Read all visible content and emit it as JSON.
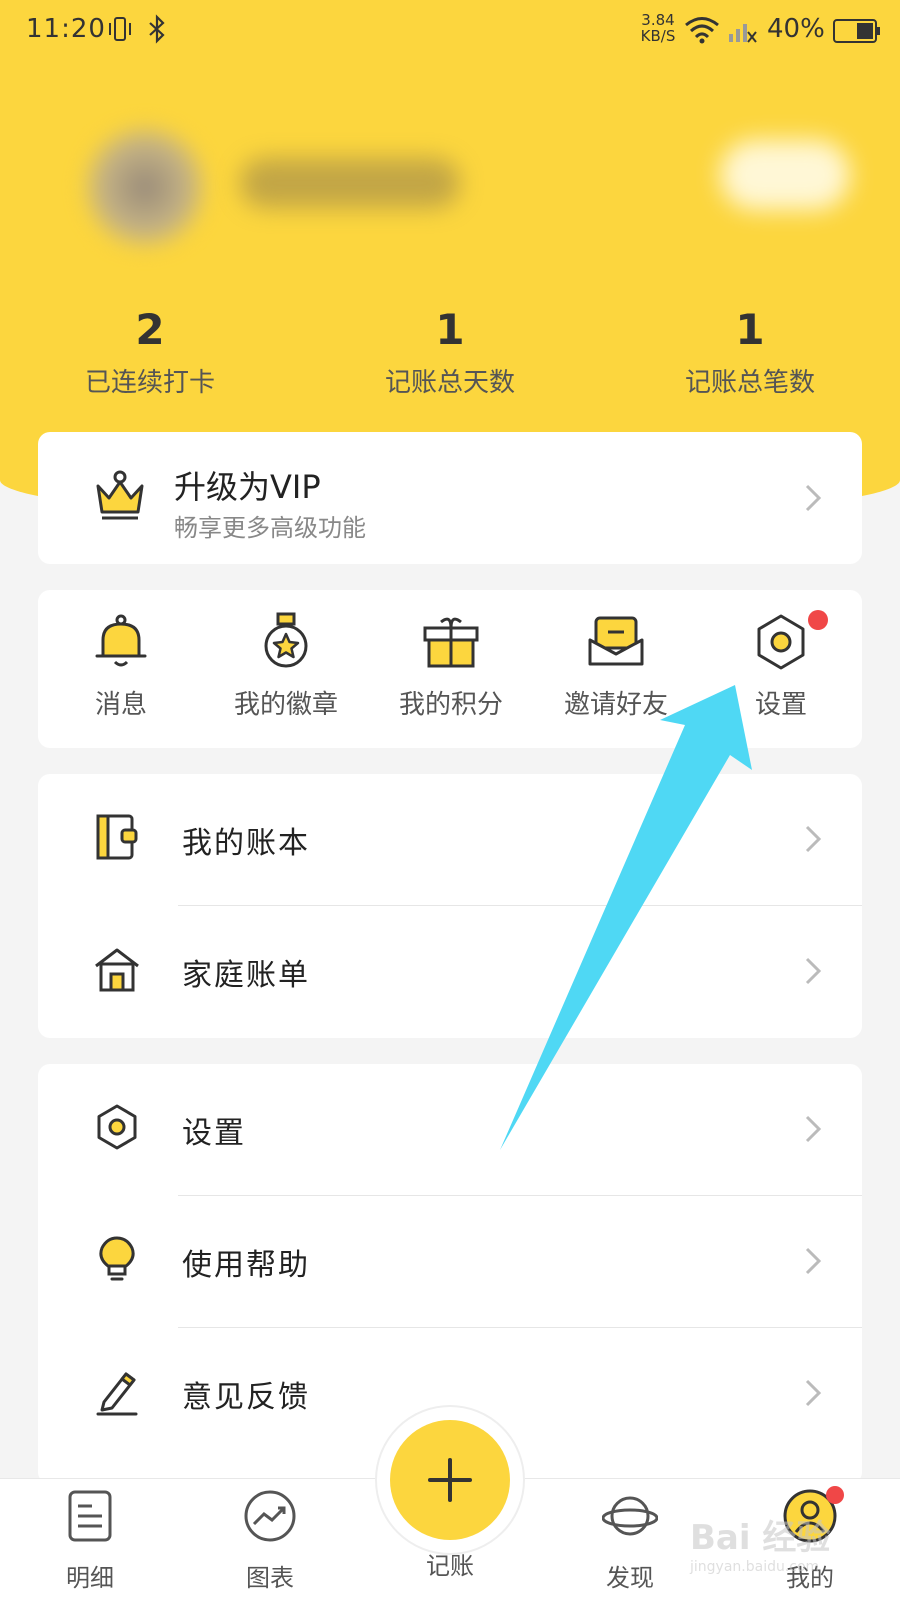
{
  "status_bar": {
    "time": "11:20",
    "speed": "3.84",
    "speed_unit": "KB/S",
    "battery": "40%"
  },
  "stats": [
    {
      "value": "2",
      "label": "已连续打卡"
    },
    {
      "value": "1",
      "label": "记账总天数"
    },
    {
      "value": "1",
      "label": "记账总笔数"
    }
  ],
  "vip": {
    "title": "升级为VIP",
    "subtitle": "畅享更多高级功能",
    "icon": "crown-icon"
  },
  "quick_actions": [
    {
      "label": "消息",
      "icon": "bell-icon"
    },
    {
      "label": "我的徽章",
      "icon": "medal-icon"
    },
    {
      "label": "我的积分",
      "icon": "gift-icon"
    },
    {
      "label": "邀请好友",
      "icon": "mail-icon"
    },
    {
      "label": "设置",
      "icon": "hexagon-settings-icon"
    }
  ],
  "books_menu": [
    {
      "label": "我的账本",
      "icon": "ledger-icon"
    },
    {
      "label": "家庭账单",
      "icon": "house-icon"
    }
  ],
  "main_menu": [
    {
      "label": "设置",
      "icon": "hexagon-settings-icon"
    },
    {
      "label": "使用帮助",
      "icon": "lightbulb-icon"
    },
    {
      "label": "意见反馈",
      "icon": "pencil-icon"
    }
  ],
  "bottom_nav": [
    {
      "label": "明细",
      "icon": "list-icon"
    },
    {
      "label": "图表",
      "icon": "chart-icon"
    },
    {
      "label": "记账",
      "icon": "plus-icon"
    },
    {
      "label": "发现",
      "icon": "planet-icon"
    },
    {
      "label": "我的",
      "icon": "user-icon"
    }
  ],
  "watermark": {
    "logo": "Bai 经验",
    "url": "jingyan.baidu.com"
  },
  "colors": {
    "brand_yellow": "#fcd63e",
    "badge_red": "#f04747",
    "arrow_cyan": "#4fd8f4"
  }
}
